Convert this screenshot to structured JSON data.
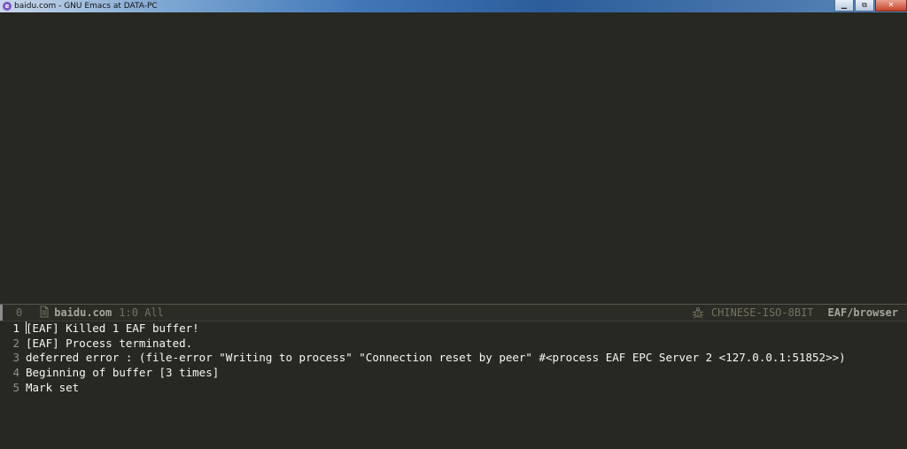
{
  "window": {
    "app_icon_glyph": "e",
    "title": "baidu.com - GNU Emacs at DATA-PC",
    "controls": {
      "minimize": "▁",
      "maximize": "⧉",
      "close": "✕"
    }
  },
  "modeline": {
    "window_number": "0",
    "buffer_icon": "file-icon",
    "buffer_name": "baidu.com",
    "position": "1:0 All",
    "debug_icon": "bug-icon",
    "encoding": "CHINESE-ISO-8BIT",
    "major_mode": "EAF/browser"
  },
  "messages": [
    {
      "line": "1",
      "text": "[EAF] Killed 1 EAF buffer!"
    },
    {
      "line": "2",
      "text": "[EAF] Process terminated."
    },
    {
      "line": "3",
      "text": "deferred error : (file-error \"Writing to process\" \"Connection reset by peer\" #<process EAF EPC Server 2 <127.0.0.1:51852>>)"
    },
    {
      "line": "4",
      "text": "Beginning of buffer [3 times]"
    },
    {
      "line": "5",
      "text": "Mark set"
    }
  ],
  "colors": {
    "background": "#272822",
    "foreground": "#f8f8f2",
    "comment": "#75715e",
    "line_number": "#8f908a"
  }
}
